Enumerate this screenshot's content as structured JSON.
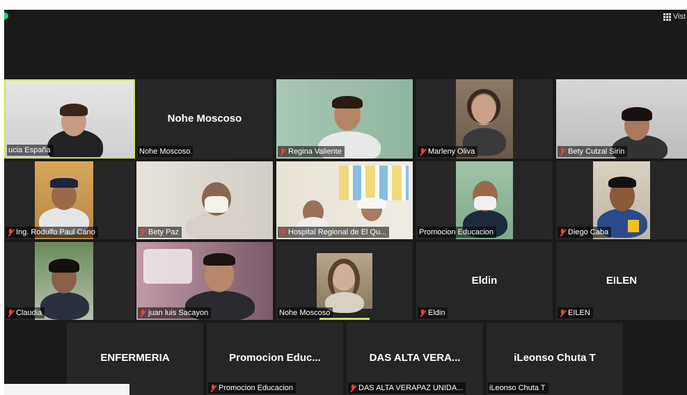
{
  "toolbar": {
    "view_label": "Vist"
  },
  "tiles": [
    {
      "id": "lucia",
      "label": "ucia España",
      "center_name": "",
      "muted": false,
      "active": true
    },
    {
      "id": "nohe1",
      "label": "Nohe Moscoso",
      "center_name": "Nohe Moscoso",
      "muted": false,
      "active": false
    },
    {
      "id": "regina",
      "label": "Regina Valiente",
      "center_name": "",
      "muted": true,
      "active": false
    },
    {
      "id": "marleny",
      "label": "Marleny Oliva",
      "center_name": "",
      "muted": true,
      "active": false
    },
    {
      "id": "bety_cutzal",
      "label": "Bety Cutzal Sirin",
      "center_name": "",
      "muted": true,
      "active": false
    },
    {
      "id": "rodulfo",
      "label": "Ing. Rodulfo Paul Cano",
      "center_name": "",
      "muted": true,
      "active": false
    },
    {
      "id": "bety_paz",
      "label": "Bety Paz",
      "center_name": "",
      "muted": true,
      "active": false
    },
    {
      "id": "hospital",
      "label": "Hospital Regional de El Qu...",
      "center_name": "",
      "muted": true,
      "active": false
    },
    {
      "id": "promocion1",
      "label": "Promocion Educacion",
      "center_name": "",
      "muted": false,
      "active": false
    },
    {
      "id": "diego",
      "label": "Diego Caba",
      "center_name": "",
      "muted": true,
      "active": false
    },
    {
      "id": "claudia",
      "label": "Claudia",
      "center_name": "",
      "muted": true,
      "active": false
    },
    {
      "id": "juan",
      "label": "juan luis Sacayon",
      "center_name": "",
      "muted": true,
      "active": false
    },
    {
      "id": "nohe2",
      "label": "Nohe Moscoso",
      "center_name": "",
      "muted": false,
      "active": false
    },
    {
      "id": "eldin",
      "label": "Eldin",
      "center_name": "Eldin",
      "muted": true,
      "active": false
    },
    {
      "id": "eilen",
      "label": "EILEN",
      "center_name": "EILEN",
      "muted": true,
      "active": false
    },
    {
      "id": "enfermeria",
      "label": "",
      "center_name": "ENFERMERIA",
      "muted": false,
      "active": false
    },
    {
      "id": "promocion2",
      "label": "Promocion Educacion",
      "center_name": "Promocion  Educ...",
      "muted": true,
      "active": false
    },
    {
      "id": "das",
      "label": "DAS ALTA VERAPAZ UNIDA...",
      "center_name": "DAS ALTA VERA...",
      "muted": true,
      "active": false
    },
    {
      "id": "leonso",
      "label": "iLeonso Chuta T",
      "center_name": "iLeonso Chuta T",
      "muted": false,
      "active": false
    }
  ],
  "colors": {
    "background": "#1a1a1a",
    "tile": "#262626",
    "active_border": "#c8e35a",
    "muted_icon": "#e8403a"
  }
}
